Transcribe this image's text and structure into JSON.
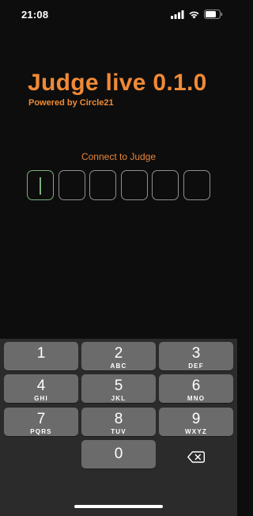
{
  "status": {
    "time": "21:08"
  },
  "app": {
    "title": "Judge live 0.1.0",
    "subtitle": "Powered by Circle21",
    "connect_label": "Connect to Judge",
    "code_length": 6,
    "code_value": ""
  },
  "colors": {
    "accent": "#f08a36",
    "active_box": "#7fae7f",
    "box_border": "#8f8f8f",
    "key_bg": "#6b6b6b",
    "keyboard_bg": "#2b2b2b"
  },
  "keyboard": {
    "keys": [
      {
        "digit": "1",
        "letters": ""
      },
      {
        "digit": "2",
        "letters": "ABC"
      },
      {
        "digit": "3",
        "letters": "DEF"
      },
      {
        "digit": "4",
        "letters": "GHI"
      },
      {
        "digit": "5",
        "letters": "JKL"
      },
      {
        "digit": "6",
        "letters": "MNO"
      },
      {
        "digit": "7",
        "letters": "PQRS"
      },
      {
        "digit": "8",
        "letters": "TUV"
      },
      {
        "digit": "9",
        "letters": "WXYZ"
      }
    ],
    "zero": {
      "digit": "0"
    },
    "backspace_icon": "backspace-icon"
  }
}
